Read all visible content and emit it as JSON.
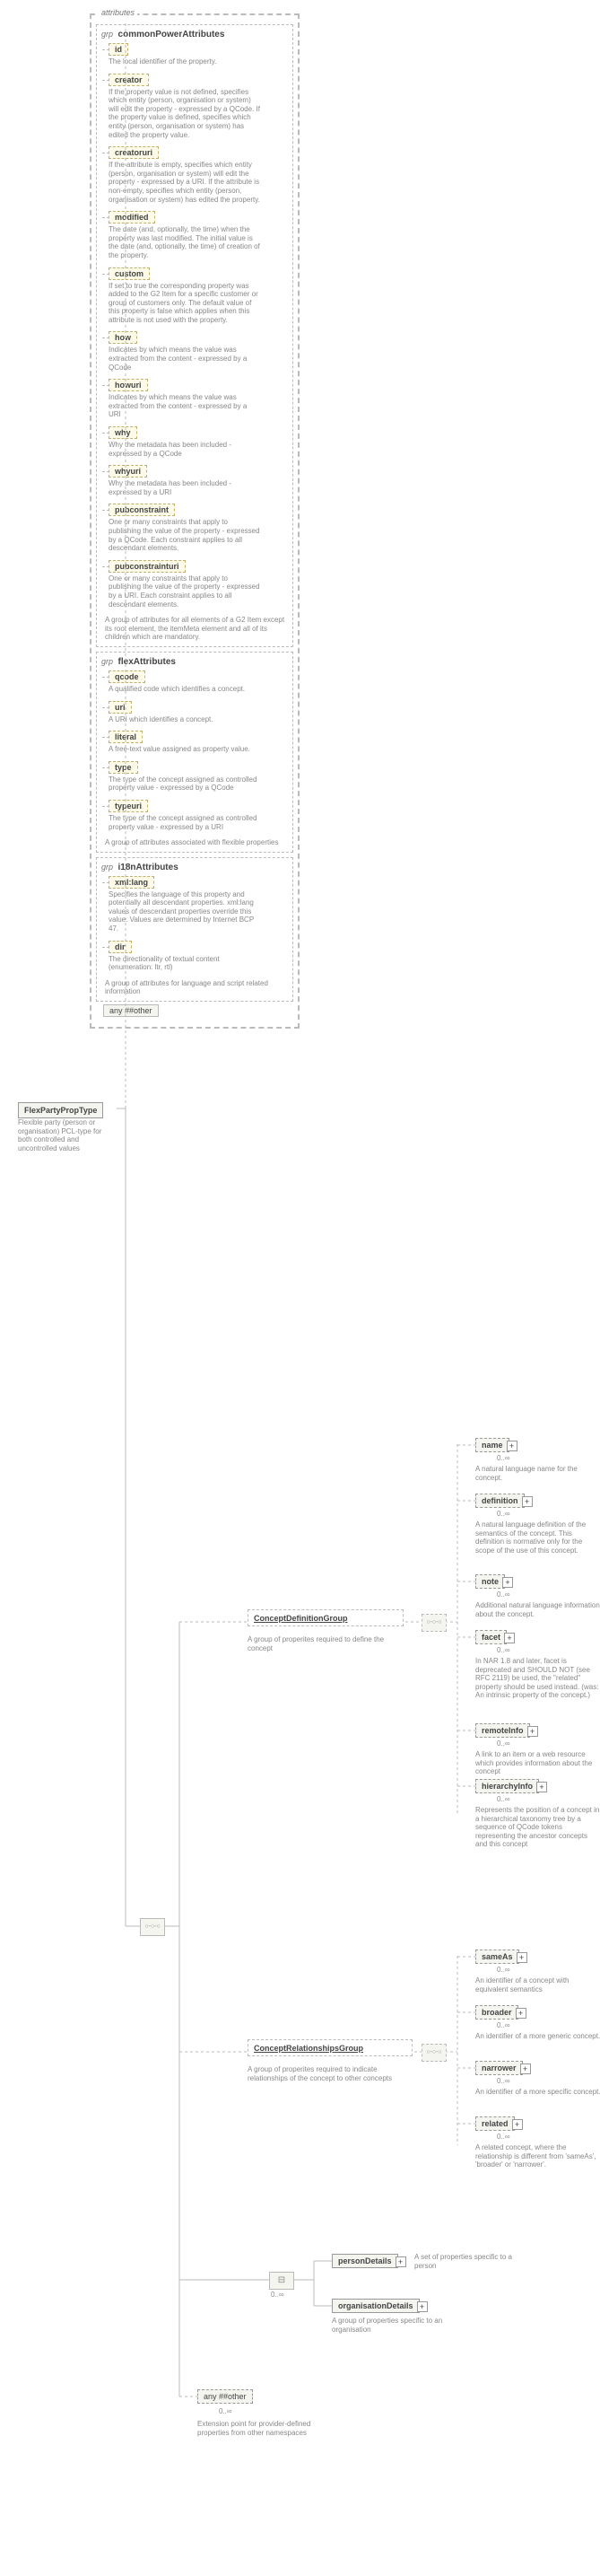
{
  "root": {
    "name": "FlexPartyPropType",
    "desc": "Flexible party (person or organisation) PCL-type for both controlled and uncontrolled values"
  },
  "attrTab": "attributes",
  "groups": [
    {
      "title": "commonPowerAttributes",
      "grp": "grp",
      "attrs": [
        {
          "n": "id",
          "d": "The local identifier of the property."
        },
        {
          "n": "creator",
          "d": "If the property value is not defined, specifies which entity (person, organisation or system) will edit the property - expressed by a QCode. If the property value is defined, specifies which entity (person, organisation or system) has edited the property value."
        },
        {
          "n": "creatoruri",
          "d": "If the attribute is empty, specifies which entity (person, organisation or system) will edit the property - expressed by a URI. If the attribute is non-empty, specifies which entity (person, organisation or system) has edited the property."
        },
        {
          "n": "modified",
          "d": "The date (and, optionally, the time) when the property was last modified. The initial value is the date (and, optionally, the time) of creation of the property."
        },
        {
          "n": "custom",
          "d": "If set to true the corresponding property was added to the G2 Item for a specific customer or group of customers only. The default value of this property is false which applies when this attribute is not used with the property."
        },
        {
          "n": "how",
          "d": "Indicates by which means the value was extracted from the content - expressed by a QCode"
        },
        {
          "n": "howuri",
          "d": "Indicates by which means the value was extracted from the content - expressed by a URI"
        },
        {
          "n": "why",
          "d": "Why the metadata has been included - expressed by a QCode"
        },
        {
          "n": "whyuri",
          "d": "Why the metadata has been included - expressed by a URI"
        },
        {
          "n": "pubconstraint",
          "d": "One or many constraints that apply to publishing the value of the property - expressed by a QCode. Each constraint applies to all descendant elements."
        },
        {
          "n": "pubconstrainturi",
          "d": "One or many constraints that apply to publishing the value of the property - expressed by a URI. Each constraint applies to all descendant elements."
        }
      ],
      "gdesc": "A group of attributes for all elements of a G2 Item except its root element, the itemMeta element and all of its children which are mandatory."
    },
    {
      "title": "flexAttributes",
      "grp": "grp",
      "attrs": [
        {
          "n": "qcode",
          "d": "A qualified code which identifies a concept."
        },
        {
          "n": "uri",
          "d": "A URI which identifies a concept."
        },
        {
          "n": "literal",
          "d": "A free-text value assigned as property value."
        },
        {
          "n": "type",
          "d": "The type of the concept assigned as controlled property value - expressed by a QCode"
        },
        {
          "n": "typeuri",
          "d": "The type of the concept assigned as controlled property value - expressed by a URI"
        }
      ],
      "gdesc": "A group of attributes associated with flexible properties"
    },
    {
      "title": "i18nAttributes",
      "grp": "grp",
      "attrs": [
        {
          "n": "xml:lang",
          "d": "Specifies the language of this property and potentially all descendant properties. xml:lang values of descendant properties override this value. Values are determined by Internet BCP 47."
        },
        {
          "n": "dir",
          "d": "The directionality of textual content (enumeration: ltr, rtl)"
        }
      ],
      "gdesc": "A group of attributes for language and script related information"
    }
  ],
  "anyAttr": "any ##other",
  "cdg": {
    "title": "ConceptDefinitionGroup",
    "desc": "A group of properites required to define the concept",
    "items": [
      {
        "n": "name",
        "d": "A natural language name for the concept."
      },
      {
        "n": "definition",
        "d": "A natural language definition of the semantics of the concept. This definition is normative only for the scope of the use of this concept."
      },
      {
        "n": "note",
        "d": "Additional natural language information about the concept."
      },
      {
        "n": "facet",
        "d": "In NAR 1.8 and later, facet is deprecated and SHOULD NOT (see RFC 2119) be used, the \"related\" property should be used instead. (was: An intrinsic property of the concept.)"
      },
      {
        "n": "remoteInfo",
        "d": "A link to an item or a web resource which provides information about the concept"
      },
      {
        "n": "hierarchyInfo",
        "d": "Represents the position of a concept in a hierarchical taxonomy tree by a sequence of QCode tokens representing the ancestor concepts and this concept"
      }
    ]
  },
  "crg": {
    "title": "ConceptRelationshipsGroup",
    "desc": "A group of properites required to indicate relationships of the concept to other concepts",
    "items": [
      {
        "n": "sameAs",
        "d": "An identifier of a concept with equivalent semantics"
      },
      {
        "n": "broader",
        "d": "An identifier of a more generic concept."
      },
      {
        "n": "narrower",
        "d": "An identifier of a more specific concept."
      },
      {
        "n": "related",
        "d": "A related concept, where the relationship is different from 'sameAs', 'broader' or 'narrower'."
      }
    ]
  },
  "choice": {
    "items": [
      {
        "n": "personDetails",
        "d": "A set of properties specific to a person"
      },
      {
        "n": "organisationDetails",
        "d": "A group of properties specific to an organisation"
      }
    ]
  },
  "anyElem": {
    "t": "any ##other",
    "c": "0..∞",
    "d": "Extension point for provider-defined properties from other namespaces"
  },
  "chart_data": null
}
